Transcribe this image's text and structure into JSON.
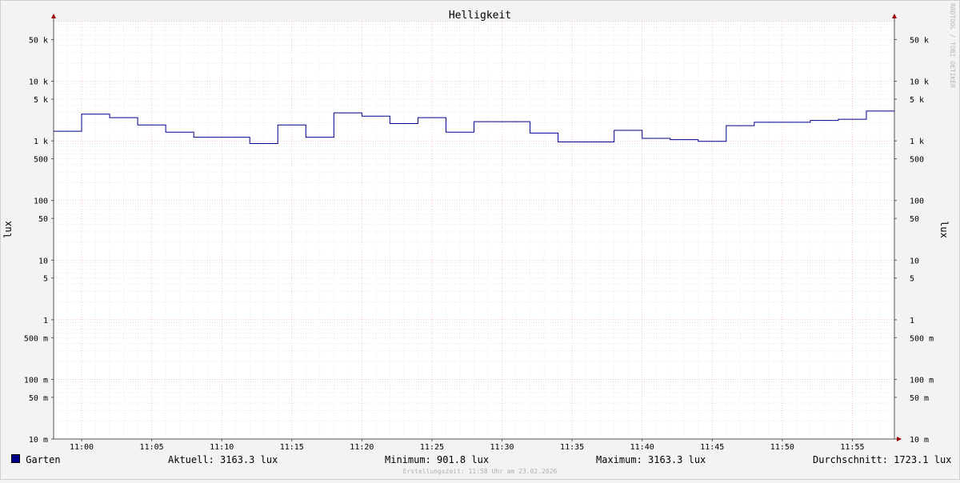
{
  "chart_data": {
    "type": "line",
    "title": "Helligkeit",
    "ylabel": "lux",
    "y_scale": "log",
    "ylim": [
      0.01,
      100000
    ],
    "y_ticks": [
      {
        "value": 50000,
        "label": "50 k"
      },
      {
        "value": 10000,
        "label": "10 k"
      },
      {
        "value": 5000,
        "label": "5 k"
      },
      {
        "value": 1000,
        "label": "1 k"
      },
      {
        "value": 500,
        "label": "500"
      },
      {
        "value": 100,
        "label": "100"
      },
      {
        "value": 50,
        "label": "50"
      },
      {
        "value": 10,
        "label": "10"
      },
      {
        "value": 5,
        "label": "5"
      },
      {
        "value": 1,
        "label": "1"
      },
      {
        "value": 0.5,
        "label": "500 m"
      },
      {
        "value": 0.1,
        "label": "100 m"
      },
      {
        "value": 0.05,
        "label": "50 m"
      },
      {
        "value": 0.01,
        "label": "10 m"
      }
    ],
    "xlim": [
      "10:58",
      "11:58"
    ],
    "x_ticks": [
      "11:00",
      "11:05",
      "11:10",
      "11:15",
      "11:20",
      "11:25",
      "11:30",
      "11:35",
      "11:40",
      "11:45",
      "11:50",
      "11:55"
    ],
    "grid": true,
    "series": [
      {
        "name": "Garten",
        "color": "#00008b",
        "step": true,
        "x": [
          "10:58",
          "11:00",
          "11:02",
          "11:04",
          "11:06",
          "11:08",
          "11:10",
          "11:12",
          "11:14",
          "11:16",
          "11:18",
          "11:20",
          "11:22",
          "11:24",
          "11:26",
          "11:28",
          "11:30",
          "11:32",
          "11:34",
          "11:36",
          "11:38",
          "11:40",
          "11:42",
          "11:44",
          "11:46",
          "11:48",
          "11:50",
          "11:52",
          "11:54",
          "11:56"
        ],
        "values": [
          1450,
          2800,
          2450,
          1850,
          1400,
          1150,
          1150,
          901.8,
          1850,
          1150,
          2950,
          2600,
          1950,
          2450,
          1400,
          2100,
          2100,
          1350,
          960,
          960,
          1500,
          1100,
          1050,
          980,
          1800,
          2050,
          2050,
          2200,
          2300,
          3163.3
        ]
      }
    ],
    "legend": {
      "position": "bottom-left",
      "name": "Garten",
      "current": "Aktuell: 3163.3 lux",
      "minimum": "Minimum: 901.8 lux",
      "maximum": "Maximum: 3163.3 lux",
      "average": "Durchschnitt: 1723.1 lux"
    },
    "watermark": "RRDTOOL / TOBI OETIKER",
    "created": "Erstellungszeit: 11:58 Uhr am 23.02.2026"
  }
}
